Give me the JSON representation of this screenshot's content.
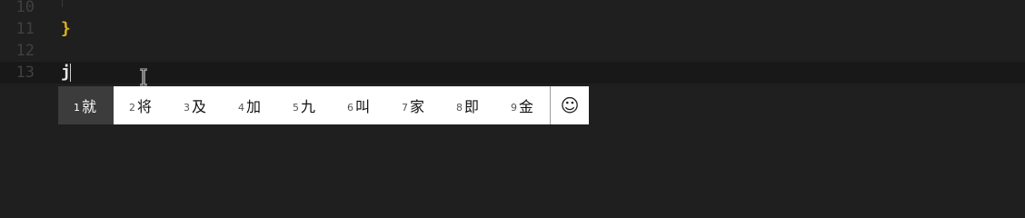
{
  "editor": {
    "lines": [
      {
        "number": "10",
        "text": ""
      },
      {
        "number": "11",
        "text": "}"
      },
      {
        "number": "12",
        "text": ""
      },
      {
        "number": "13",
        "text": "j"
      }
    ]
  },
  "ime": {
    "candidates": [
      {
        "index": "1",
        "char": "就"
      },
      {
        "index": "2",
        "char": "将"
      },
      {
        "index": "3",
        "char": "及"
      },
      {
        "index": "4",
        "char": "加"
      },
      {
        "index": "5",
        "char": "九"
      },
      {
        "index": "6",
        "char": "叫"
      },
      {
        "index": "7",
        "char": "家"
      },
      {
        "index": "8",
        "char": "即"
      },
      {
        "index": "9",
        "char": "金"
      }
    ],
    "emoji_button": "☺",
    "selected_index": "1"
  },
  "colors": {
    "background": "#1f1f1f",
    "current_line": "#181818",
    "line_number": "#404040",
    "brace": "#e0b420",
    "text": "#e6e6e6",
    "selected_candidate": "#3c3c3c"
  }
}
